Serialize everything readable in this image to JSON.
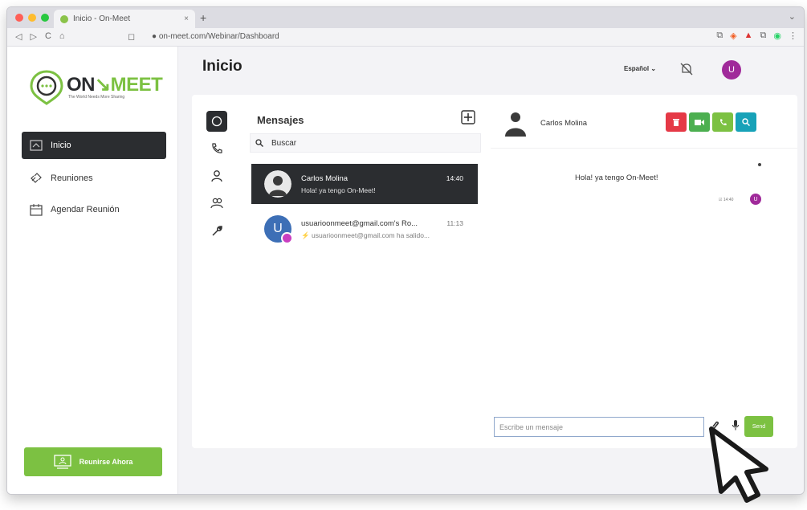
{
  "browser": {
    "tab_title": "Inicio - On-Meet",
    "tab_close": "×",
    "new_tab": "+",
    "tab_menu": "⌄",
    "url": "on-meet.com/Webinar/Dashboard",
    "nav": {
      "back": "◁",
      "forward": "▷",
      "reload": "C",
      "home": "⌂"
    },
    "bookmark": "◻",
    "extensions": [
      "⧉",
      "◈",
      "▲",
      "⧉",
      "◉",
      "⋮"
    ]
  },
  "brand": {
    "logo_on": "ON",
    "logo_meet": "MEET",
    "tagline": "The World Needs More Sharing",
    "green": "#7cc142",
    "dark": "#2b2d30"
  },
  "sidebar": {
    "items": [
      {
        "label": "Inicio",
        "icon": "home-icon",
        "active": true
      },
      {
        "label": "Reuniones",
        "icon": "link-icon",
        "active": false
      },
      {
        "label": "Agendar Reunión",
        "icon": "calendar-icon",
        "active": false
      }
    ],
    "cta_label": "Reunirse Ahora"
  },
  "header": {
    "title": "Inicio",
    "language": "Español ⌄",
    "user_initial": "U"
  },
  "messages": {
    "title": "Mensajes",
    "search_placeholder": "Buscar",
    "conversations": [
      {
        "name": "Carlos Molina",
        "preview": "Hola! ya tengo On-Meet!",
        "time": "14:40",
        "active": true
      },
      {
        "name": "usuarioonmeet@gmail.com's Ro...",
        "preview": "usuarioonmeet@gmail.com ha salido...",
        "preview_icon": "⚡",
        "time": "11:13",
        "avatar_initial": "U",
        "active": false
      }
    ]
  },
  "chat": {
    "contact_name": "Carlos Molina",
    "action_colors": {
      "delete": "#e53946",
      "video": "#4caf50",
      "call": "#7cc142",
      "search": "#17a2b8"
    },
    "messages": [
      {
        "text": "Hola! ya tengo On-Meet!",
        "time": "☑ 14:40",
        "avatar_initial": "U"
      }
    ],
    "composer_placeholder": "Escribe un mensaje",
    "send_label": "Send"
  }
}
